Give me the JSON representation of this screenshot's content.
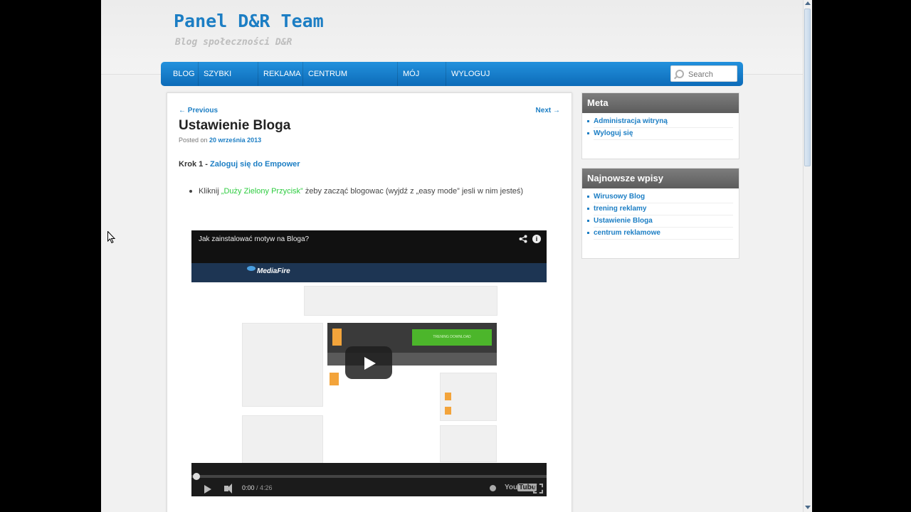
{
  "site": {
    "title": "Panel D&R Team",
    "description": "Blog społeczności D&R"
  },
  "nav": {
    "items": [
      {
        "label": "Blog"
      },
      {
        "label": "Szybki Start"
      },
      {
        "label": "Reklama"
      },
      {
        "label": "Centrum Reklamowe"
      },
      {
        "label": "Mój Profi"
      },
      {
        "label": "Wyloguj się"
      }
    ],
    "search_placeholder": "Search"
  },
  "post": {
    "prev_label": "← Previous",
    "next_label": "Next →",
    "title": "Ustawienie Bloga",
    "posted_on": "Posted on",
    "date": "20 września 2013",
    "step_prefix": "Krok 1 - ",
    "step_link": "Zaloguj się do Empower",
    "bullet_prefix": "Kliknij ",
    "bullet_link": "„Duży Zielony Przycisk”",
    "bullet_suffix": " żeby zacząć blogowac (wyjdź z „easy mode” jesli w nim jesteś)"
  },
  "video": {
    "title": "Jak zainstalować motyw na Bloga?",
    "mediafire_label": "MediaFire",
    "download_button": "TRENING DOWNLOAD",
    "time_current": "0:00",
    "time_duration": " / 4:26",
    "progress_fraction": 0,
    "youtube_label": "You",
    "youtube_label2": "Tube"
  },
  "sidebar": {
    "meta": {
      "heading": "Meta",
      "links": [
        "Administracja witryną",
        "Wyloguj się"
      ]
    },
    "recent": {
      "heading": "Najnowsze wpisy",
      "links": [
        "Wirusowy Blog",
        "trening reklamy",
        "Ustawienie Bloga",
        "centrum reklamowe"
      ]
    }
  },
  "colors": {
    "accent": "#1c7ec4",
    "nav": "#1782cf",
    "green_link": "#2ecc40"
  }
}
